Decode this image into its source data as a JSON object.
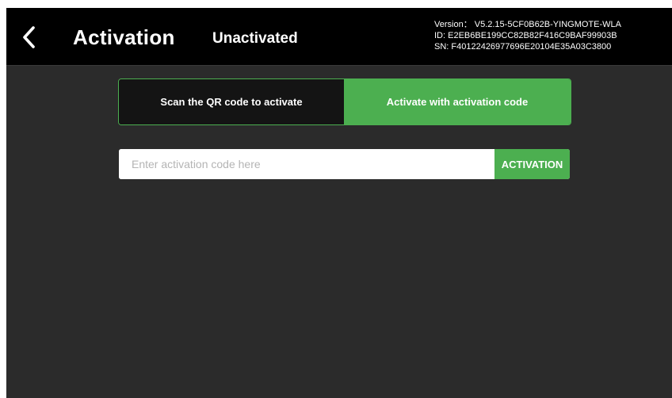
{
  "header": {
    "back_icon": "chevron-left-icon",
    "title": "Activation",
    "status": "Unactivated",
    "version_line": "Version： V5.2.15-5CF0B62B-YINGMOTE-WLA",
    "id_line": "ID: E2EB6BE199CC82B82F416C9BAF99903B",
    "sn_line": "SN: F40122426977696E20104E35A03C3800"
  },
  "tabs": [
    {
      "label": "Scan the QR code to activate",
      "selected": false
    },
    {
      "label": "Activate with activation code",
      "selected": true
    }
  ],
  "activation": {
    "input_value": "",
    "placeholder": "Enter activation code here",
    "button_label": "ACTIVATION"
  },
  "colors": {
    "accent": "#4caf50",
    "header_bg": "#000000",
    "body_bg": "#2b2b2b",
    "tab_inactive_bg": "#141414"
  }
}
